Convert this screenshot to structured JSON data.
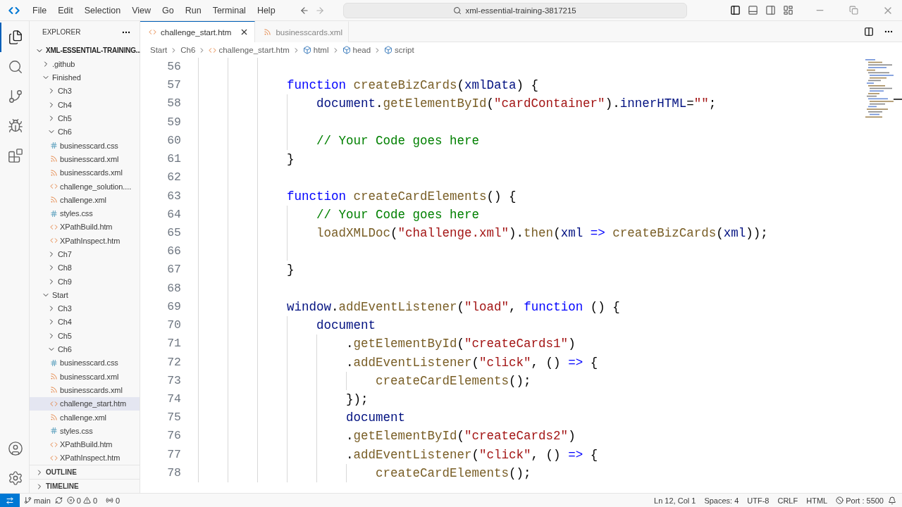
{
  "menu": [
    "File",
    "Edit",
    "Selection",
    "View",
    "Go",
    "Run",
    "Terminal",
    "Help"
  ],
  "command_center": {
    "value": "xml-essential-training-3817215"
  },
  "activity_bar": [
    {
      "kind": "explorer",
      "selected": true
    },
    {
      "kind": "search",
      "selected": false
    },
    {
      "kind": "source-control",
      "selected": false
    },
    {
      "kind": "debug",
      "selected": false
    },
    {
      "kind": "extensions",
      "selected": false
    }
  ],
  "explorer": {
    "title": "EXPLORER",
    "root": {
      "label": "XML-ESSENTIAL-TRAINING...",
      "expanded": true
    },
    "tree": [
      {
        "label": ".github",
        "kind": "folder",
        "expanded": false,
        "selected": false
      },
      {
        "label": "Finished",
        "kind": "folder",
        "expanded": true,
        "selected": false,
        "children": [
          {
            "label": "Ch3",
            "kind": "folder",
            "expanded": false,
            "selected": false
          },
          {
            "label": "Ch4",
            "kind": "folder",
            "expanded": false,
            "selected": false
          },
          {
            "label": "Ch5",
            "kind": "folder",
            "expanded": false,
            "selected": false
          },
          {
            "label": "Ch6",
            "kind": "folder",
            "expanded": true,
            "selected": false,
            "children": [
              {
                "label": "businesscard.css",
                "kind": "css",
                "selected": false
              },
              {
                "label": "businesscard.xml",
                "kind": "xml",
                "selected": false
              },
              {
                "label": "businesscards.xml",
                "kind": "xml",
                "selected": false
              },
              {
                "label": "challenge_solution....",
                "kind": "html",
                "selected": false
              },
              {
                "label": "challenge.xml",
                "kind": "xml",
                "selected": false
              },
              {
                "label": "styles.css",
                "kind": "css",
                "selected": false
              },
              {
                "label": "XPathBuild.htm",
                "kind": "html",
                "selected": false
              },
              {
                "label": "XPathInspect.htm",
                "kind": "html",
                "selected": false
              }
            ]
          },
          {
            "label": "Ch7",
            "kind": "folder",
            "expanded": false,
            "selected": false
          },
          {
            "label": "Ch8",
            "kind": "folder",
            "expanded": false,
            "selected": false
          },
          {
            "label": "Ch9",
            "kind": "folder",
            "expanded": false,
            "selected": false
          }
        ]
      },
      {
        "label": "Start",
        "kind": "folder",
        "expanded": true,
        "selected": false,
        "children": [
          {
            "label": "Ch3",
            "kind": "folder",
            "expanded": false,
            "selected": false
          },
          {
            "label": "Ch4",
            "kind": "folder",
            "expanded": false,
            "selected": false
          },
          {
            "label": "Ch5",
            "kind": "folder",
            "expanded": false,
            "selected": false
          },
          {
            "label": "Ch6",
            "kind": "folder",
            "expanded": true,
            "selected": false,
            "children": [
              {
                "label": "businesscard.css",
                "kind": "css",
                "selected": false
              },
              {
                "label": "businesscard.xml",
                "kind": "xml",
                "selected": false
              },
              {
                "label": "businesscards.xml",
                "kind": "xml",
                "selected": false
              },
              {
                "label": "challenge_start.htm",
                "kind": "html",
                "selected": true
              },
              {
                "label": "challenge.xml",
                "kind": "xml",
                "selected": false
              },
              {
                "label": "styles.css",
                "kind": "css",
                "selected": false
              },
              {
                "label": "XPathBuild.htm",
                "kind": "html",
                "selected": false
              },
              {
                "label": "XPathInspect.htm",
                "kind": "html",
                "selected": false
              }
            ]
          }
        ]
      }
    ],
    "sections": [
      {
        "label": "OUTLINE",
        "expanded": false
      },
      {
        "label": "TIMELINE",
        "expanded": false
      }
    ]
  },
  "tabs": [
    {
      "label": "challenge_start.htm",
      "kind": "html",
      "selected": true
    },
    {
      "label": "businesscards.xml",
      "kind": "xml",
      "selected": false
    }
  ],
  "breadcrumbs": [
    {
      "label": "Start",
      "kind": "folder"
    },
    {
      "label": "Ch6",
      "kind": "folder"
    },
    {
      "label": "challenge_start.htm",
      "kind": "html"
    },
    {
      "label": "html",
      "kind": "element"
    },
    {
      "label": "head",
      "kind": "element"
    },
    {
      "label": "script",
      "kind": "element"
    }
  ],
  "code_lines": [
    {
      "number": "56"
    },
    {
      "number": "57",
      "tokens": [
        {
          "kind": "kw",
          "text": "            function"
        },
        {
          "kind": "fn",
          "text": " createBizCards"
        },
        {
          "kind": "p",
          "text": "("
        },
        {
          "kind": "var",
          "text": "xmlData"
        },
        {
          "kind": "p",
          "text": ") {"
        }
      ]
    },
    {
      "number": "58",
      "tokens": [
        {
          "kind": "var",
          "text": "                document"
        },
        {
          "kind": "p",
          "text": "."
        },
        {
          "kind": "fn",
          "text": "getElementById"
        },
        {
          "kind": "p",
          "text": "("
        },
        {
          "kind": "str",
          "text": "\"cardContainer\""
        },
        {
          "kind": "p",
          "text": ")."
        },
        {
          "kind": "var",
          "text": "innerHTML"
        },
        {
          "kind": "p",
          "text": "="
        },
        {
          "kind": "str",
          "text": "\"\""
        },
        {
          "kind": "p",
          "text": ";"
        }
      ]
    },
    {
      "number": "59"
    },
    {
      "number": "60",
      "tokens": [
        {
          "kind": "cm",
          "text": "                // Your Code goes here"
        }
      ]
    },
    {
      "number": "61",
      "tokens": [
        {
          "kind": "p",
          "text": "            }"
        }
      ]
    },
    {
      "number": "62"
    },
    {
      "number": "63",
      "tokens": [
        {
          "kind": "kw",
          "text": "            function"
        },
        {
          "kind": "fn",
          "text": " createCardElements"
        },
        {
          "kind": "p",
          "text": "() {"
        }
      ]
    },
    {
      "number": "64",
      "tokens": [
        {
          "kind": "cm",
          "text": "                // Your Code goes here"
        }
      ]
    },
    {
      "number": "65",
      "tokens": [
        {
          "kind": "fn",
          "text": "                loadXMLDoc"
        },
        {
          "kind": "p",
          "text": "("
        },
        {
          "kind": "str",
          "text": "\"challenge.xml\""
        },
        {
          "kind": "p",
          "text": ")."
        },
        {
          "kind": "fn",
          "text": "then"
        },
        {
          "kind": "p",
          "text": "("
        },
        {
          "kind": "var",
          "text": "xml"
        },
        {
          "kind": "kw",
          "text": " =>"
        },
        {
          "kind": "fn",
          "text": " createBizCards"
        },
        {
          "kind": "p",
          "text": "("
        },
        {
          "kind": "var",
          "text": "xml"
        },
        {
          "kind": "p",
          "text": "));"
        }
      ]
    },
    {
      "number": "66"
    },
    {
      "number": "67",
      "tokens": [
        {
          "kind": "p",
          "text": "            }"
        }
      ]
    },
    {
      "number": "68"
    },
    {
      "number": "69",
      "tokens": [
        {
          "kind": "var",
          "text": "            window"
        },
        {
          "kind": "p",
          "text": "."
        },
        {
          "kind": "fn",
          "text": "addEventListener"
        },
        {
          "kind": "p",
          "text": "("
        },
        {
          "kind": "str",
          "text": "\"load\""
        },
        {
          "kind": "p",
          "text": ", "
        },
        {
          "kind": "kw",
          "text": "function"
        },
        {
          "kind": "p",
          "text": " () {"
        }
      ]
    },
    {
      "number": "70",
      "tokens": [
        {
          "kind": "var",
          "text": "                document"
        }
      ]
    },
    {
      "number": "71",
      "tokens": [
        {
          "kind": "p",
          "text": "                    ."
        },
        {
          "kind": "fn",
          "text": "getElementById"
        },
        {
          "kind": "p",
          "text": "("
        },
        {
          "kind": "str",
          "text": "\"createCards1\""
        },
        {
          "kind": "p",
          "text": ")"
        }
      ]
    },
    {
      "number": "72",
      "tokens": [
        {
          "kind": "p",
          "text": "                    ."
        },
        {
          "kind": "fn",
          "text": "addEventListener"
        },
        {
          "kind": "p",
          "text": "("
        },
        {
          "kind": "str",
          "text": "\"click\""
        },
        {
          "kind": "p",
          "text": ", ()"
        },
        {
          "kind": "kw",
          "text": " =>"
        },
        {
          "kind": "p",
          "text": " {"
        }
      ]
    },
    {
      "number": "73",
      "tokens": [
        {
          "kind": "fn",
          "text": "                        createCardElements"
        },
        {
          "kind": "p",
          "text": "();"
        }
      ]
    },
    {
      "number": "74",
      "tokens": [
        {
          "kind": "p",
          "text": "                    });"
        }
      ]
    },
    {
      "number": "75",
      "tokens": [
        {
          "kind": "var",
          "text": "                    document"
        }
      ]
    },
    {
      "number": "76",
      "tokens": [
        {
          "kind": "p",
          "text": "                    ."
        },
        {
          "kind": "fn",
          "text": "getElementById"
        },
        {
          "kind": "p",
          "text": "("
        },
        {
          "kind": "str",
          "text": "\"createCards2\""
        },
        {
          "kind": "p",
          "text": ")"
        }
      ]
    },
    {
      "number": "77",
      "tokens": [
        {
          "kind": "p",
          "text": "                    ."
        },
        {
          "kind": "fn",
          "text": "addEventListener"
        },
        {
          "kind": "p",
          "text": "("
        },
        {
          "kind": "str",
          "text": "\"click\""
        },
        {
          "kind": "p",
          "text": ", ()"
        },
        {
          "kind": "kw",
          "text": " =>"
        },
        {
          "kind": "p",
          "text": " {"
        }
      ]
    },
    {
      "number": "78",
      "tokens": [
        {
          "kind": "fn",
          "text": "                        createCardElements"
        },
        {
          "kind": "p",
          "text": "();"
        }
      ]
    }
  ],
  "status_bar": {
    "branch": "main",
    "errors": "0",
    "warnings": "0",
    "ports": "0",
    "right": [
      {
        "label": "Ln 12, Col 1",
        "kind": "text"
      },
      {
        "label": "Spaces: 4",
        "kind": "text"
      },
      {
        "label": "UTF-8",
        "kind": "text"
      },
      {
        "label": "CRLF",
        "kind": "text"
      },
      {
        "label": "HTML",
        "kind": "text"
      },
      {
        "label": "Port : 5500",
        "kind": "port"
      }
    ]
  }
}
